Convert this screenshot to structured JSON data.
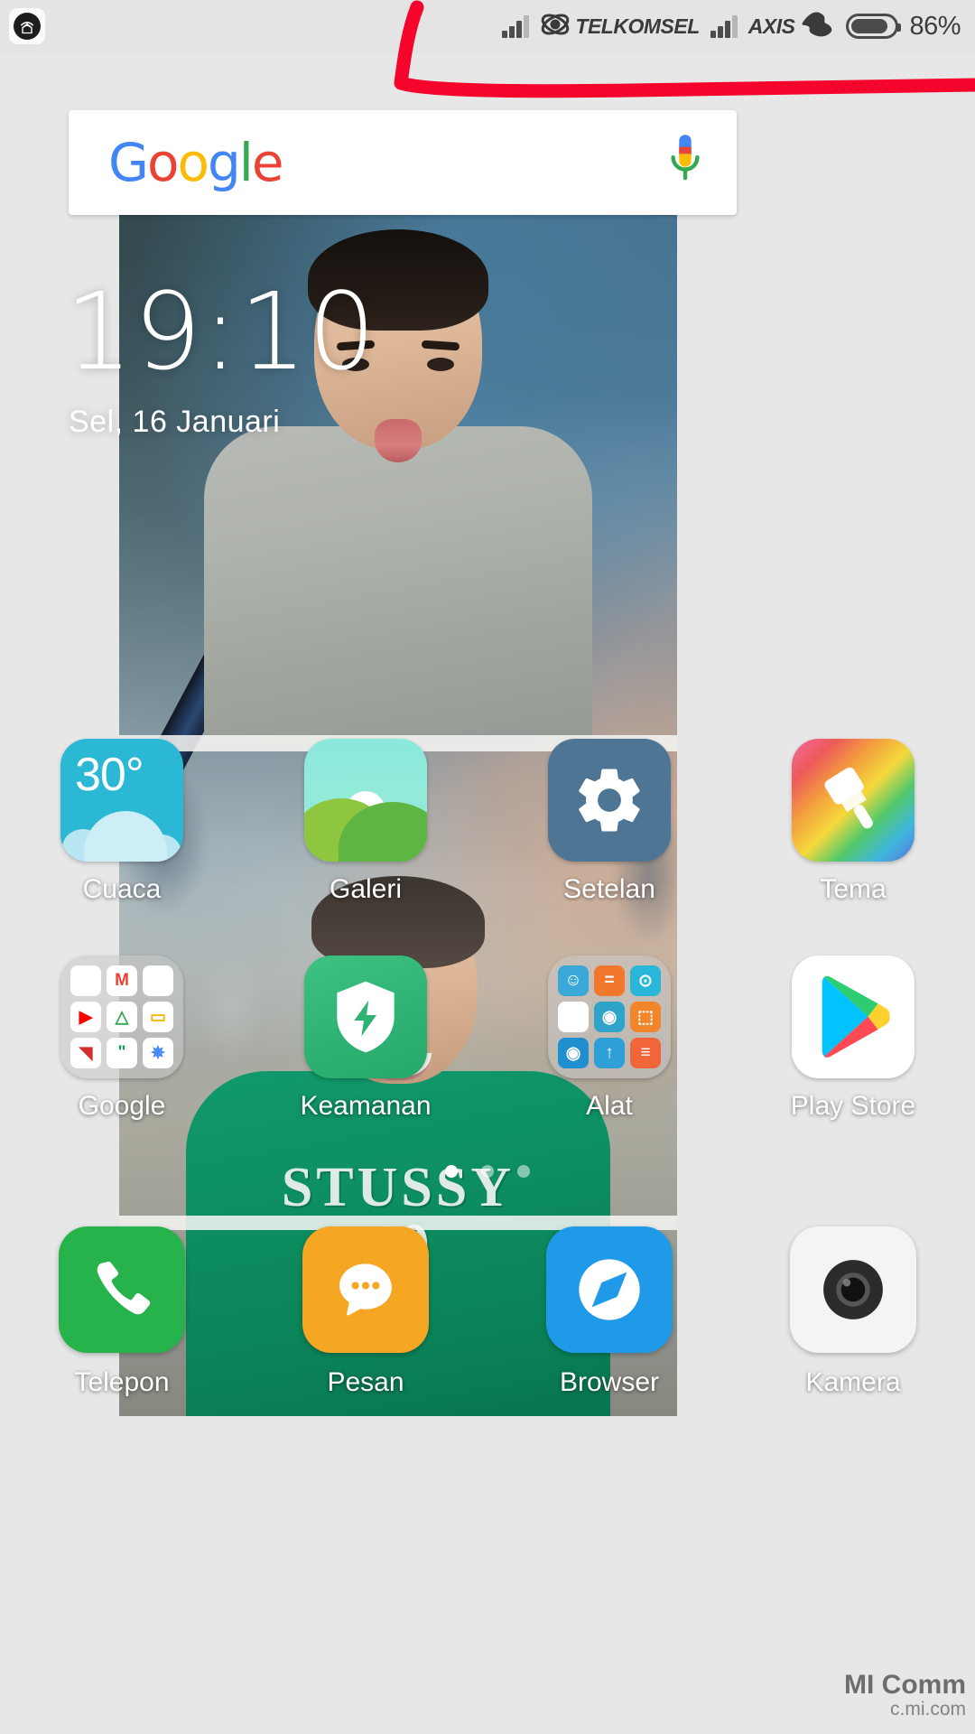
{
  "status_bar": {
    "notification_icon": "wifi-home-notification-icon",
    "sims": [
      {
        "carrier": "TELKOMSEL",
        "signal_bars": 3,
        "signal_total": 4,
        "logo": "telkomsel-logo"
      },
      {
        "carrier": "AXIS",
        "signal_bars": 3,
        "signal_total": 4,
        "logo": "axis-logo"
      }
    ],
    "battery": {
      "percent_label": "86%",
      "level": 86,
      "icon": "battery-icon"
    }
  },
  "annotation": {
    "color": "#f5052b",
    "shape": "hand-drawn-red-bracket-around-status-bar"
  },
  "google_widget": {
    "logo_letters": [
      {
        "char": "G",
        "color": "#4285F4"
      },
      {
        "char": "o",
        "color": "#EA4335"
      },
      {
        "char": "o",
        "color": "#FBBC05"
      },
      {
        "char": "g",
        "color": "#4285F4"
      },
      {
        "char": "l",
        "color": "#34A853"
      },
      {
        "char": "e",
        "color": "#EA4335"
      }
    ],
    "mic_icon": "microphone-icon"
  },
  "clock_widget": {
    "time": "19:10",
    "date": "Sel, 16 Januari"
  },
  "app_rows": [
    [
      {
        "label": "Cuaca",
        "icon": "weather-icon",
        "temperature": "30°"
      },
      {
        "label": "Galeri",
        "icon": "gallery-icon"
      },
      {
        "label": "Setelan",
        "icon": "settings-gear-icon"
      },
      {
        "label": "Tema",
        "icon": "themes-paintbrush-icon"
      }
    ],
    [
      {
        "label": "Google",
        "icon": "google-folder-icon"
      },
      {
        "label": "Keamanan",
        "icon": "security-shield-icon"
      },
      {
        "label": "Alat",
        "icon": "tools-folder-icon"
      },
      {
        "label": "Play Store",
        "icon": "play-store-icon"
      }
    ]
  ],
  "google_folder_apps": [
    {
      "name": "voice-search-icon",
      "bg": "#ffffff",
      "fg": "#4285F4",
      "glyph": "\u0001"
    },
    {
      "name": "gmail-icon",
      "bg": "#ffffff",
      "fg": "#EA4335",
      "glyph": "M"
    },
    {
      "name": "maps-icon",
      "bg": "#ffffff",
      "fg": "#34A853",
      "glyph": "\u0002"
    },
    {
      "name": "youtube-icon",
      "bg": "#ffffff",
      "fg": "#FF0000",
      "glyph": "▶"
    },
    {
      "name": "drive-icon",
      "bg": "#ffffff",
      "fg": "#34A853",
      "glyph": "△"
    },
    {
      "name": "slides-icon",
      "bg": "#ffffff",
      "fg": "#F4B400",
      "glyph": "▭"
    },
    {
      "name": "play-newsstand-icon",
      "bg": "#ffffff",
      "fg": "#D32F2F",
      "glyph": "◥"
    },
    {
      "name": "hangouts-icon",
      "bg": "#ffffff",
      "fg": "#0F9D58",
      "glyph": "\""
    },
    {
      "name": "photos-icon",
      "bg": "#ffffff",
      "fg": "#4285F4",
      "glyph": "✵"
    }
  ],
  "tools_folder_apps": [
    {
      "name": "contacts-icon",
      "bg": "#3aa8d8",
      "glyph": "☺"
    },
    {
      "name": "calculator-icon",
      "bg": "#f0772b",
      "glyph": "="
    },
    {
      "name": "compass-icon",
      "bg": "#29b6d8",
      "glyph": "⊙"
    },
    {
      "name": "mail-icon",
      "bg": "#ffffff",
      "glyph": "✉"
    },
    {
      "name": "screen-recorder-icon",
      "bg": "#2fa3c9",
      "glyph": "◉"
    },
    {
      "name": "scanner-icon",
      "bg": "#f0852b",
      "glyph": "⬚"
    },
    {
      "name": "downloads-icon",
      "bg": "#1f8fd0",
      "glyph": "◉"
    },
    {
      "name": "mi-drop-icon",
      "bg": "#2f9fd8",
      "glyph": "↑"
    },
    {
      "name": "notes-icon",
      "bg": "#f0663a",
      "glyph": "≡"
    }
  ],
  "page_indicator": {
    "total": 3,
    "active_index": 0
  },
  "dock": [
    {
      "label": "Telepon",
      "icon": "phone-icon"
    },
    {
      "label": "Pesan",
      "icon": "message-icon"
    },
    {
      "label": "Browser",
      "icon": "browser-compass-icon"
    },
    {
      "label": "Kamera",
      "icon": "camera-icon"
    }
  ],
  "watermark": {
    "line1": "MI Comm",
    "line2": "c.mi.com"
  }
}
